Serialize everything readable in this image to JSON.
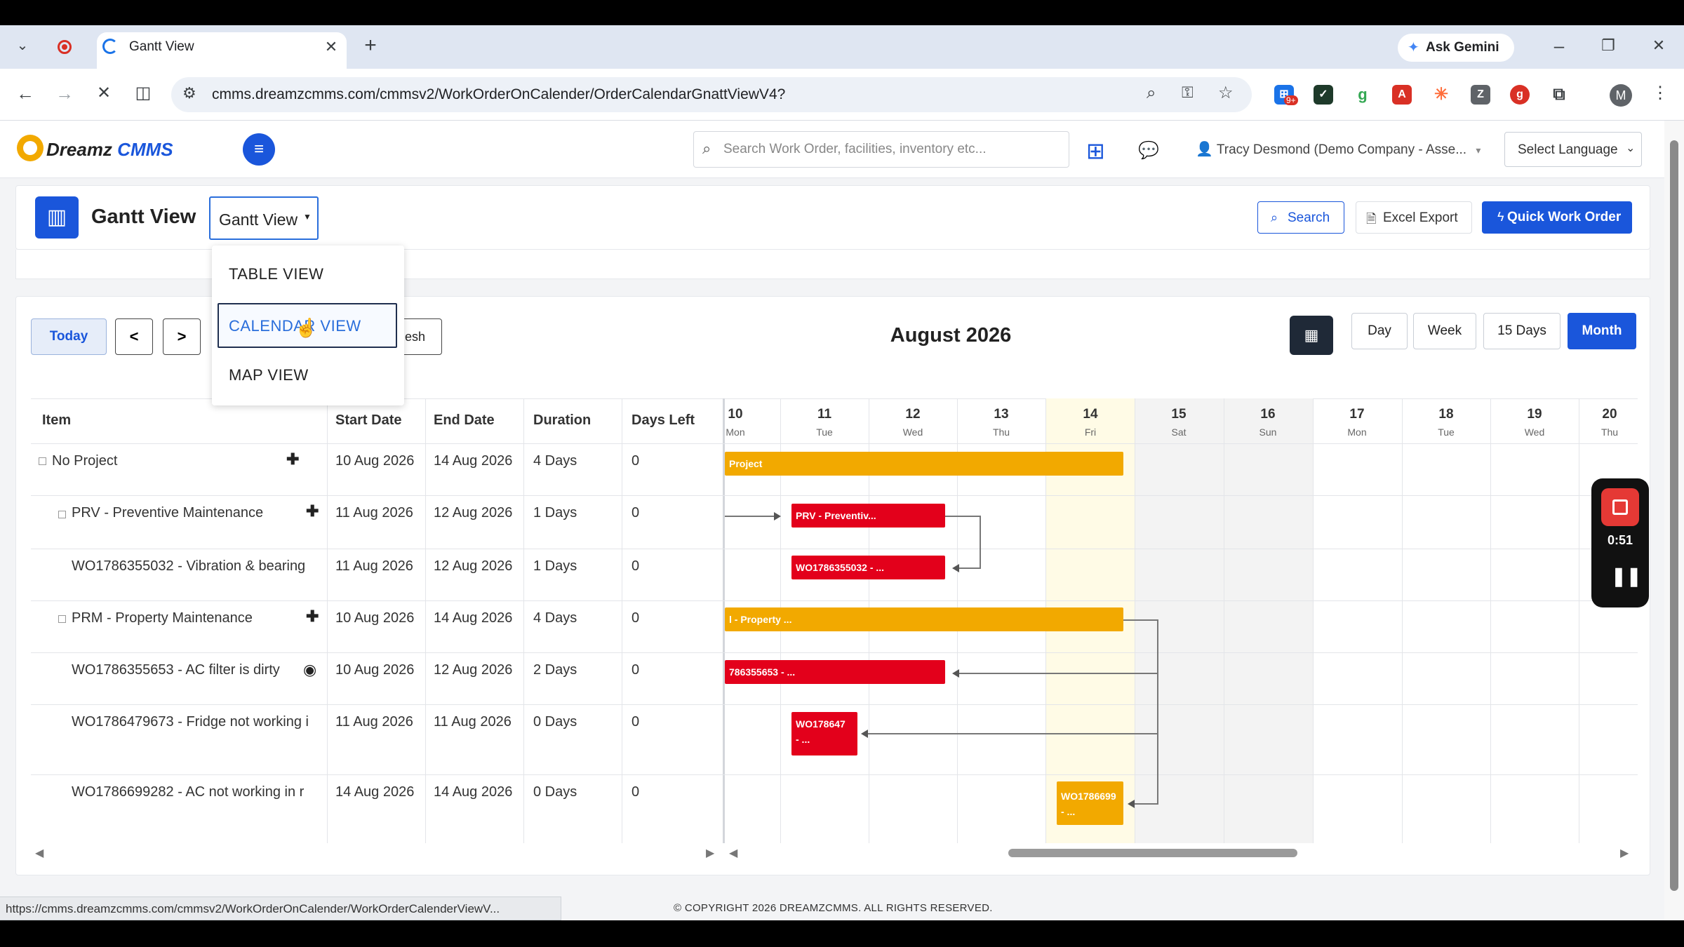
{
  "browser": {
    "tab_title": "Gantt View",
    "ask_gemini": "Ask Gemini",
    "url": "cmms.dreamzcmms.com/cmmsv2/WorkOrderOnCalender/OrderCalendarGnattViewV4?",
    "ext_badge": "9+",
    "profile_initial": "M",
    "status_url": "https://cmms.dreamzcmms.com/cmmsv2/WorkOrderOnCalender/WorkOrderCalenderViewV..."
  },
  "app": {
    "logo_text_1": "Dreamz",
    "logo_text_2": "CMMS",
    "search_placeholder": "Search Work Order, facilities, inventory etc...",
    "user_name": "Tracy Desmond (Demo Company - Asse...",
    "language_select": "Select Language",
    "page_title": "Gantt View",
    "view_dropdown": "Gantt View",
    "view_menu": [
      "TABLE VIEW",
      "CALENDAR VIEW",
      "MAP VIEW"
    ],
    "btn_search": "Search",
    "btn_excel": "Excel Export",
    "btn_quick": "Quick Work Order",
    "footer": "© COPYRIGHT 2026 DREAMZCMMS. ALL RIGHTS RESERVED."
  },
  "calendar": {
    "btn_today": "Today",
    "btn_prev": "<",
    "btn_next": ">",
    "btn_refresh_partial": "esh",
    "month_title": "August 2026",
    "scale_buttons": [
      "Day",
      "Week",
      "15 Days",
      "Month"
    ],
    "active_scale": "Month",
    "columns": [
      "Item",
      "Start Date",
      "End Date",
      "Duration",
      "Days Left"
    ],
    "days": [
      {
        "num": "10",
        "name": "Mon"
      },
      {
        "num": "11",
        "name": "Tue"
      },
      {
        "num": "12",
        "name": "Wed"
      },
      {
        "num": "13",
        "name": "Thu"
      },
      {
        "num": "14",
        "name": "Fri"
      },
      {
        "num": "15",
        "name": "Sat"
      },
      {
        "num": "16",
        "name": "Sun"
      },
      {
        "num": "17",
        "name": "Mon"
      },
      {
        "num": "18",
        "name": "Tue"
      },
      {
        "num": "19",
        "name": "Wed"
      },
      {
        "num": "20",
        "name": "Thu"
      }
    ],
    "rows": [
      {
        "item": "No Project",
        "start": "10 Aug 2026",
        "end": "14 Aug 2026",
        "duration": "4 Days",
        "left": "0",
        "bar": "Project"
      },
      {
        "item": "PRV - Preventive Maintenance",
        "start": "11 Aug 2026",
        "end": "12 Aug 2026",
        "duration": "1 Days",
        "left": "0",
        "bar": "PRV - Preventiv..."
      },
      {
        "item": "WO1786355032 - Vibration & bearing",
        "start": "11 Aug 2026",
        "end": "12 Aug 2026",
        "duration": "1 Days",
        "left": "0",
        "bar": "WO1786355032 - ..."
      },
      {
        "item": "PRM - Property Maintenance",
        "start": "10 Aug 2026",
        "end": "14 Aug 2026",
        "duration": "4 Days",
        "left": "0",
        "bar": "l - Property ..."
      },
      {
        "item": "WO1786355653 - AC filter is dirty",
        "start": "10 Aug 2026",
        "end": "12 Aug 2026",
        "duration": "2 Days",
        "left": "0",
        "bar": "786355653 - ..."
      },
      {
        "item": "WO1786479673 - Fridge not working i",
        "start": "11 Aug 2026",
        "end": "11 Aug 2026",
        "duration": "0 Days",
        "left": "0",
        "bar": "WO178647⁠",
        "bar2": "- ..."
      },
      {
        "item": "WO1786699282 - AC not working in r",
        "start": "14 Aug 2026",
        "end": "14 Aug 2026",
        "duration": "0 Days",
        "left": "0",
        "bar": "WO1786699",
        "bar2": "- ..."
      }
    ]
  },
  "recorder": {
    "time": "0:51"
  },
  "colors": {
    "primary": "#1a56db",
    "orange": "#f2a900",
    "red": "#e3001b",
    "today_col": "#fffbe6",
    "weekend_col": "#f4f4f4"
  }
}
